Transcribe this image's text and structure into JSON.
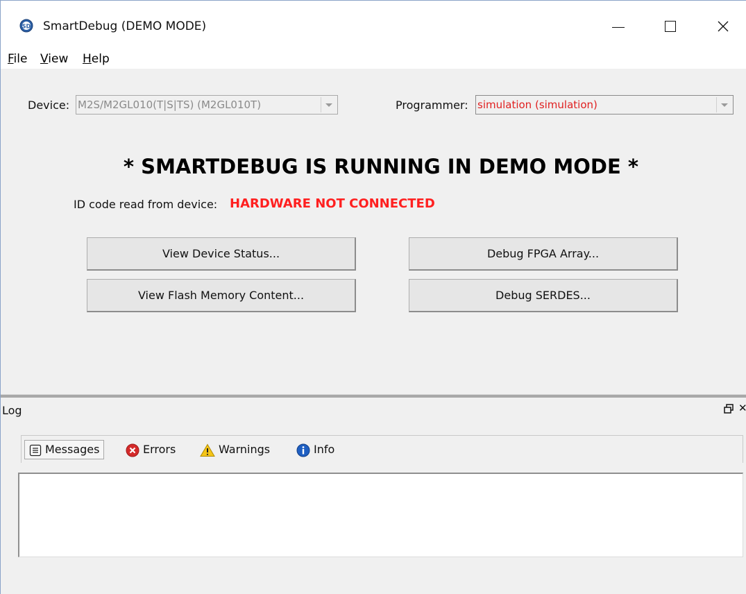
{
  "window": {
    "title": "SmartDebug (DEMO MODE)",
    "app_icon": "smartdebug-logo-icon",
    "controls": [
      "minimize-icon",
      "maximize-icon",
      "close-icon"
    ]
  },
  "menu": {
    "file": {
      "mnemonic": "F",
      "rest": "ile"
    },
    "view": {
      "mnemonic": "V",
      "rest": "iew"
    },
    "help": {
      "mnemonic": "H",
      "rest": "elp"
    }
  },
  "device": {
    "label": "Device:",
    "value": "M2S/M2GL010(T|S|TS) (M2GL010T)"
  },
  "programmer": {
    "label": "Programmer:",
    "value": "simulation (simulation)"
  },
  "banner": "* SMARTDEBUG IS RUNNING IN DEMO MODE *",
  "id_code": {
    "label": "ID code read from device:",
    "value": "HARDWARE NOT CONNECTED"
  },
  "buttons": {
    "view_device_status": "View Device Status...",
    "view_flash_memory": "View Flash Memory Content...",
    "debug_fpga_array": "Debug FPGA Array...",
    "debug_serdes": "Debug SERDES..."
  },
  "log": {
    "title": "Log",
    "tabs": {
      "messages": "Messages",
      "errors": "Errors",
      "warnings": "Warnings",
      "info": "Info"
    }
  },
  "colors": {
    "accent_red": "#ff2020",
    "programmer_red": "#e02020",
    "window_bg": "#f0f0f0"
  }
}
